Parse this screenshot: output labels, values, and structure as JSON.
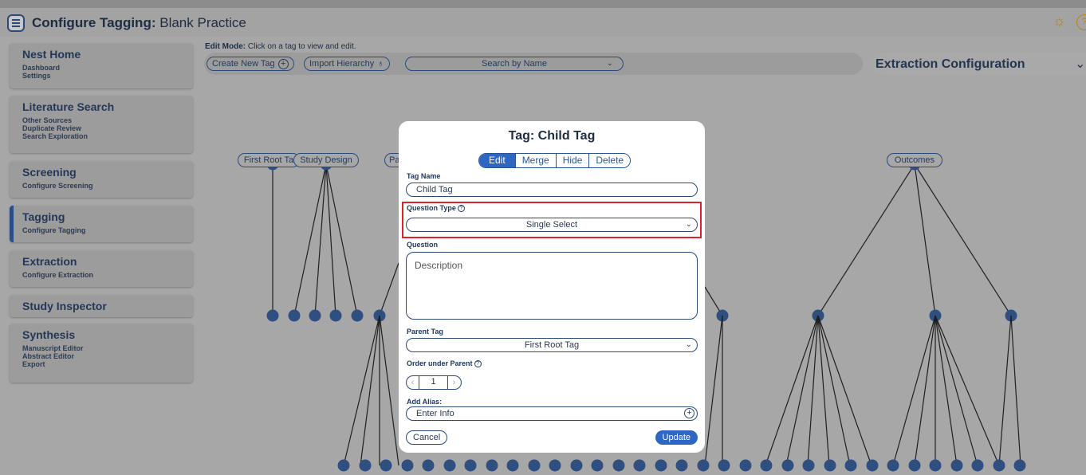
{
  "colors": {
    "accent": "#2d66c3",
    "node": "#2f4f80",
    "highlight": "#e0202a",
    "overlay": "#a7a7a7"
  },
  "header": {
    "title_bold": "Configure Tagging:",
    "title_project": "Blank Practice",
    "icons": [
      "menu-icon",
      "lightbulb-icon",
      "help-icon"
    ]
  },
  "sidebar": {
    "sections": [
      {
        "title": "Nest Home",
        "items": [
          "Dashboard",
          "Settings"
        ]
      },
      {
        "title": "Literature Search",
        "items": [
          "Other Sources",
          "Duplicate Review",
          "Search Exploration"
        ]
      },
      {
        "title": "Screening",
        "items": [
          "Configure Screening"
        ]
      },
      {
        "title": "Tagging",
        "items": [
          "Configure Tagging"
        ],
        "active": true
      },
      {
        "title": "Extraction",
        "items": [
          "Configure Extraction"
        ]
      },
      {
        "title": "Study Inspector",
        "items": []
      },
      {
        "title": "Synthesis",
        "items": [
          "Manuscript Editor",
          "Abstract Editor",
          "Export"
        ]
      }
    ]
  },
  "toolbar": {
    "edit_mode_label": "Edit Mode:",
    "edit_mode_hint": "Click on a tag to view and edit.",
    "create_label": "Create New Tag",
    "import_label": "Import Hierarchy",
    "search_placeholder": "Search by Name"
  },
  "extraction_panel": {
    "title": "Extraction Configuration"
  },
  "tree": {
    "roots": [
      "First Root Ta",
      "Study Design",
      "Pa",
      "Outcomes"
    ]
  },
  "modal": {
    "title": "Tag: Child Tag",
    "tabs": [
      "Edit",
      "Merge",
      "Hide",
      "Delete"
    ],
    "active_tab": "Edit",
    "tag_name_label": "Tag Name",
    "tag_name_value": "Child Tag",
    "question_type_label": "Question Type",
    "question_type_value": "Single Select",
    "question_label": "Question",
    "question_placeholder": "Description",
    "parent_tag_label": "Parent Tag",
    "parent_tag_value": "First Root Tag",
    "order_label": "Order under Parent",
    "order_value": "1",
    "alias_label": "Add Alias:",
    "alias_placeholder": "Enter Info",
    "cancel_label": "Cancel",
    "update_label": "Update"
  }
}
